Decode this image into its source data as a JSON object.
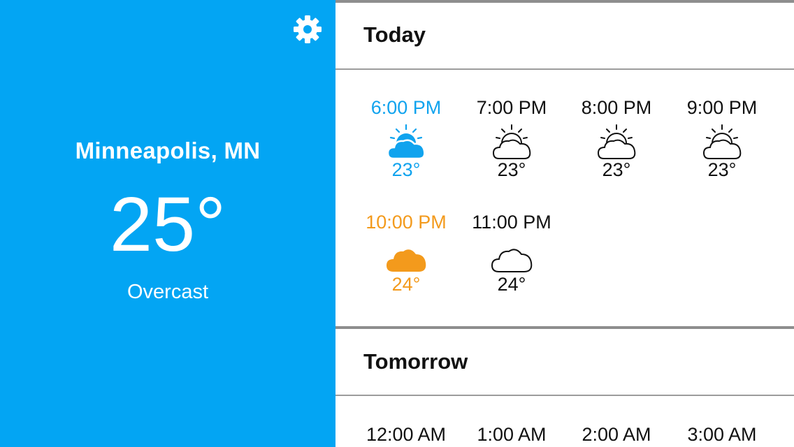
{
  "location": {
    "city": "Minneapolis, MN",
    "temperature": "25°",
    "condition": "Overcast"
  },
  "settings": {
    "icon": "gear-icon"
  },
  "today": {
    "title": "Today",
    "hours": [
      {
        "time": "6:00 PM",
        "temp": "23°",
        "icon": "partly-cloudy-icon",
        "style": "current"
      },
      {
        "time": "7:00 PM",
        "temp": "23°",
        "icon": "partly-cloudy-icon",
        "style": "normal"
      },
      {
        "time": "8:00 PM",
        "temp": "23°",
        "icon": "partly-cloudy-icon",
        "style": "normal"
      },
      {
        "time": "9:00 PM",
        "temp": "23°",
        "icon": "partly-cloudy-icon",
        "style": "normal"
      },
      {
        "time": "10:00 PM",
        "temp": "24°",
        "icon": "cloud-icon",
        "style": "highlight"
      },
      {
        "time": "11:00 PM",
        "temp": "24°",
        "icon": "cloud-icon",
        "style": "normal"
      }
    ]
  },
  "tomorrow": {
    "title": "Tomorrow",
    "hours": [
      {
        "time": "12:00 AM"
      },
      {
        "time": "1:00 AM"
      },
      {
        "time": "2:00 AM"
      },
      {
        "time": "3:00 AM"
      }
    ]
  },
  "colors": {
    "panel": "#03a5f3",
    "current": "#10a3ee",
    "highlight": "#f39a1c"
  }
}
